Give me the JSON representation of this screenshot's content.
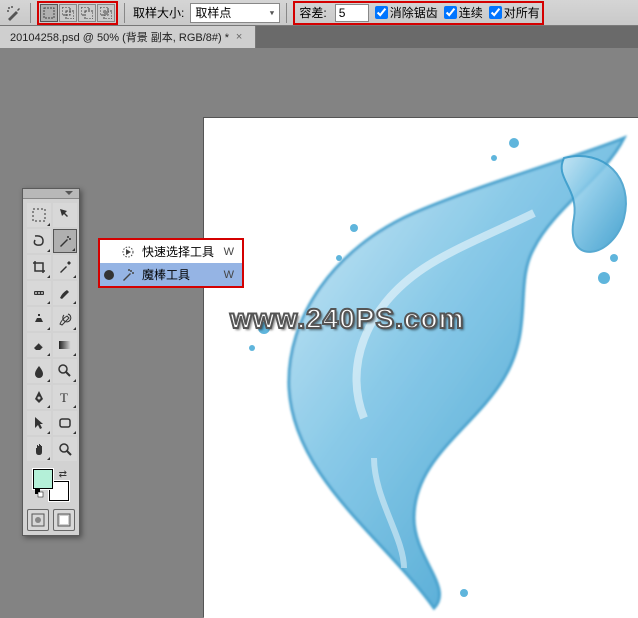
{
  "option_bar": {
    "sample_size_label": "取样大小:",
    "sample_size_value": "取样点",
    "tolerance_label": "容差:",
    "tolerance_value": "5",
    "antialias_label": "消除锯齿",
    "contiguous_label": "连续",
    "all_layers_label": "对所有",
    "antialias_checked": true,
    "contiguous_checked": true,
    "all_layers_checked": true
  },
  "doc_tab": {
    "title": "20104258.psd @ 50% (背景 副本, RGB/8#) *"
  },
  "flyout": {
    "items": [
      {
        "label": "快速选择工具",
        "key": "W",
        "selected": false,
        "icon": "brush"
      },
      {
        "label": "魔棒工具",
        "key": "W",
        "selected": true,
        "icon": "wand"
      }
    ]
  },
  "watermark": "www.240PS.com",
  "tools": {
    "names": [
      "marquee-tool",
      "move-tool",
      "lasso-tool",
      "magic-wand-tool",
      "crop-tool",
      "eyedropper-tool",
      "spot-heal-tool",
      "brush-tool",
      "clone-stamp-tool",
      "history-brush-tool",
      "eraser-tool",
      "gradient-tool",
      "blur-tool",
      "dodge-tool",
      "pen-tool",
      "type-tool",
      "path-select-tool",
      "shape-tool",
      "hand-tool",
      "zoom-tool"
    ]
  },
  "colors": {
    "foreground": "#b4f0d8",
    "background": "#ffffff"
  }
}
